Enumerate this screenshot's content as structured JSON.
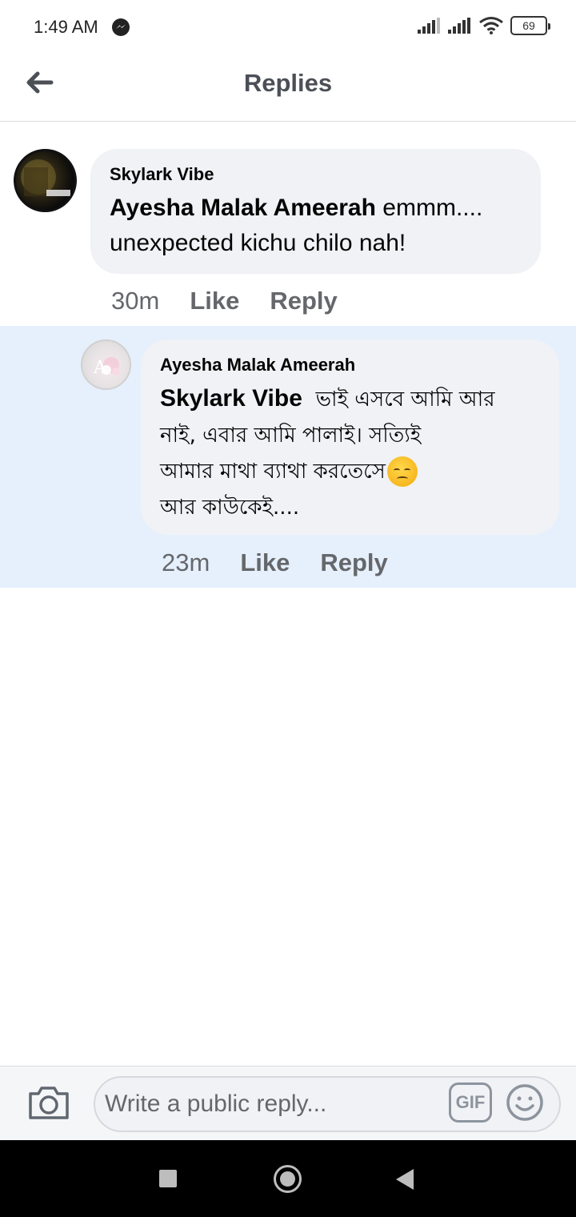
{
  "status_bar": {
    "time": "1:49 AM",
    "battery": "69",
    "icons": [
      "messenger-icon",
      "signal-icon",
      "signal-icon",
      "wifi-icon",
      "battery-icon"
    ]
  },
  "header": {
    "title": "Replies",
    "back_icon": "arrow-left-icon"
  },
  "comments": [
    {
      "author": "Skylark Vibe",
      "mention": "Ayesha Malak Ameerah",
      "text_after_mention": " emmm.... unexpected kichu chilo nah!",
      "time": "30m",
      "like_label": "Like",
      "reply_label": "Reply",
      "highlighted": false
    },
    {
      "author": "Ayesha Malak Ameerah",
      "mention": "Skylark Vibe",
      "line1": "ভাই এসবে আমি আর",
      "line2": "নাই, এবার আমি পালাই। সত্যিই",
      "line3": "আমার মাথা ব্যাথা করতেসে",
      "line4": "আর কাউকেই....",
      "emoji": "pensive-face-emoji",
      "time": "23m",
      "like_label": "Like",
      "reply_label": "Reply",
      "highlighted": true
    }
  ],
  "composer": {
    "placeholder": "Write a public reply...",
    "gif_label": "GIF",
    "camera_icon": "camera-icon",
    "emoji_icon": "smiley-icon"
  },
  "colors": {
    "highlight_bg": "#e6f0fc",
    "bubble_bg": "#f0f2f5",
    "secondary_text": "#65676b"
  }
}
